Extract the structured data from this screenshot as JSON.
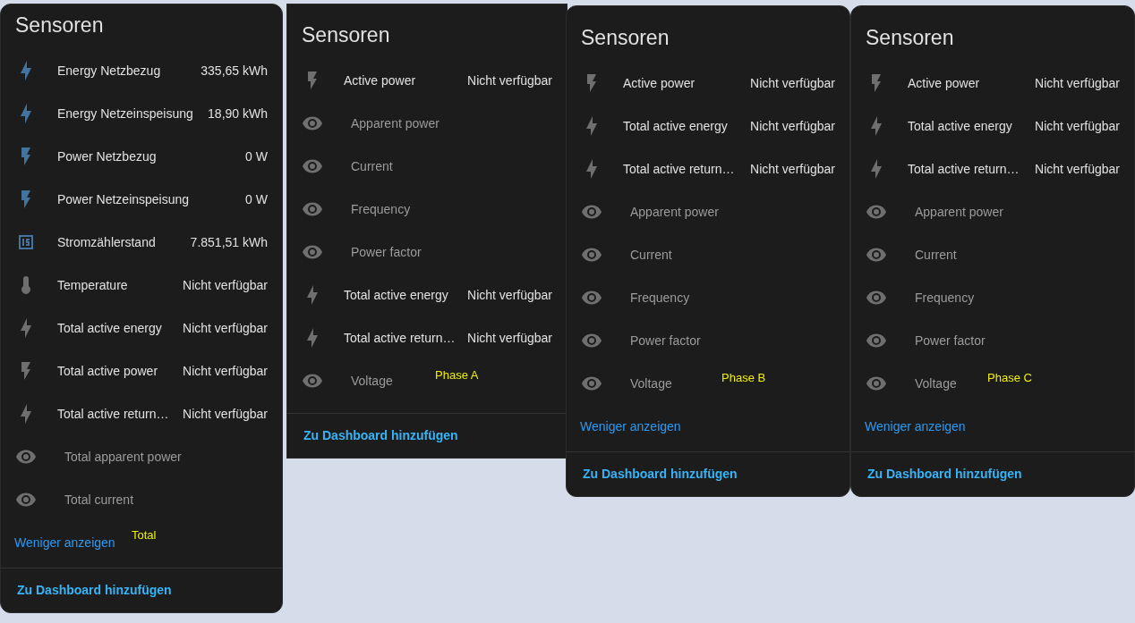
{
  "panels": [
    {
      "title": "Sensoren",
      "annotation": "Total",
      "rows": [
        {
          "kind": "bolt-energy",
          "active": true,
          "hidden": false,
          "name": "Energy Netzbezug",
          "value": "335,65 kWh"
        },
        {
          "kind": "bolt-energy",
          "active": true,
          "hidden": false,
          "name": "Energy Netzeinspeisung",
          "value": "18,90 kWh"
        },
        {
          "kind": "bolt-power",
          "active": true,
          "hidden": false,
          "name": "Power Netzbezug",
          "value": "0 W"
        },
        {
          "kind": "bolt-power",
          "active": true,
          "hidden": false,
          "name": "Power Netzeinspeisung",
          "value": "0 W"
        },
        {
          "kind": "counter",
          "active": true,
          "hidden": false,
          "name": "Stromzählerstand",
          "value": "7.851,51 kWh"
        },
        {
          "kind": "thermometer",
          "active": false,
          "hidden": false,
          "name": "Temperature",
          "value": "Nicht verfügbar"
        },
        {
          "kind": "bolt-energy",
          "active": false,
          "hidden": false,
          "name": "Total active energy",
          "value": "Nicht verfügbar"
        },
        {
          "kind": "bolt-power",
          "active": false,
          "hidden": false,
          "name": "Total active power",
          "value": "Nicht verfügbar"
        },
        {
          "kind": "bolt-energy",
          "active": false,
          "hidden": false,
          "name": "Total active return…",
          "value": "Nicht verfügbar"
        },
        {
          "kind": "eye",
          "active": false,
          "hidden": true,
          "name": "Total apparent power"
        },
        {
          "kind": "eye",
          "active": false,
          "hidden": true,
          "name": "Total current"
        }
      ],
      "show_less": "Weniger anzeigen",
      "footer_button": "Zu Dashboard hinzufügen"
    },
    {
      "title": "Sensoren",
      "annotation": "Phase A",
      "rows": [
        {
          "kind": "bolt-power",
          "active": false,
          "hidden": false,
          "name": "Active power",
          "value": "Nicht verfügbar"
        },
        {
          "kind": "eye",
          "active": false,
          "hidden": true,
          "name": "Apparent power"
        },
        {
          "kind": "eye",
          "active": false,
          "hidden": true,
          "name": "Current"
        },
        {
          "kind": "eye",
          "active": false,
          "hidden": true,
          "name": "Frequency"
        },
        {
          "kind": "eye",
          "active": false,
          "hidden": true,
          "name": "Power factor"
        },
        {
          "kind": "bolt-energy",
          "active": false,
          "hidden": false,
          "name": "Total active energy",
          "value": "Nicht verfügbar"
        },
        {
          "kind": "bolt-energy",
          "active": false,
          "hidden": false,
          "name": "Total active return…",
          "value": "Nicht verfügbar"
        },
        {
          "kind": "eye",
          "active": false,
          "hidden": true,
          "name": "Voltage"
        }
      ],
      "footer_button": "Zu Dashboard hinzufügen"
    },
    {
      "title": "Sensoren",
      "annotation": "Phase B",
      "rows": [
        {
          "kind": "bolt-power",
          "active": false,
          "hidden": false,
          "name": "Active power",
          "value": "Nicht verfügbar"
        },
        {
          "kind": "bolt-energy",
          "active": false,
          "hidden": false,
          "name": "Total active energy",
          "value": "Nicht verfügbar"
        },
        {
          "kind": "bolt-energy",
          "active": false,
          "hidden": false,
          "name": "Total active return…",
          "value": "Nicht verfügbar"
        },
        {
          "kind": "eye",
          "active": false,
          "hidden": true,
          "name": "Apparent power"
        },
        {
          "kind": "eye",
          "active": false,
          "hidden": true,
          "name": "Current"
        },
        {
          "kind": "eye",
          "active": false,
          "hidden": true,
          "name": "Frequency"
        },
        {
          "kind": "eye",
          "active": false,
          "hidden": true,
          "name": "Power factor"
        },
        {
          "kind": "eye",
          "active": false,
          "hidden": true,
          "name": "Voltage"
        }
      ],
      "show_less": "Weniger anzeigen",
      "footer_button": "Zu Dashboard hinzufügen"
    },
    {
      "title": "Sensoren",
      "annotation": "Phase C",
      "rows": [
        {
          "kind": "bolt-power",
          "active": false,
          "hidden": false,
          "name": "Active power",
          "value": "Nicht verfügbar"
        },
        {
          "kind": "bolt-energy",
          "active": false,
          "hidden": false,
          "name": "Total active energy",
          "value": "Nicht verfügbar"
        },
        {
          "kind": "bolt-energy",
          "active": false,
          "hidden": false,
          "name": "Total active return…",
          "value": "Nicht verfügbar"
        },
        {
          "kind": "eye",
          "active": false,
          "hidden": true,
          "name": "Apparent power"
        },
        {
          "kind": "eye",
          "active": false,
          "hidden": true,
          "name": "Current"
        },
        {
          "kind": "eye",
          "active": false,
          "hidden": true,
          "name": "Frequency"
        },
        {
          "kind": "eye",
          "active": false,
          "hidden": true,
          "name": "Power factor"
        },
        {
          "kind": "eye",
          "active": false,
          "hidden": true,
          "name": "Voltage"
        }
      ],
      "show_less": "Weniger anzeigen",
      "footer_button": "Zu Dashboard hinzufügen"
    }
  ]
}
